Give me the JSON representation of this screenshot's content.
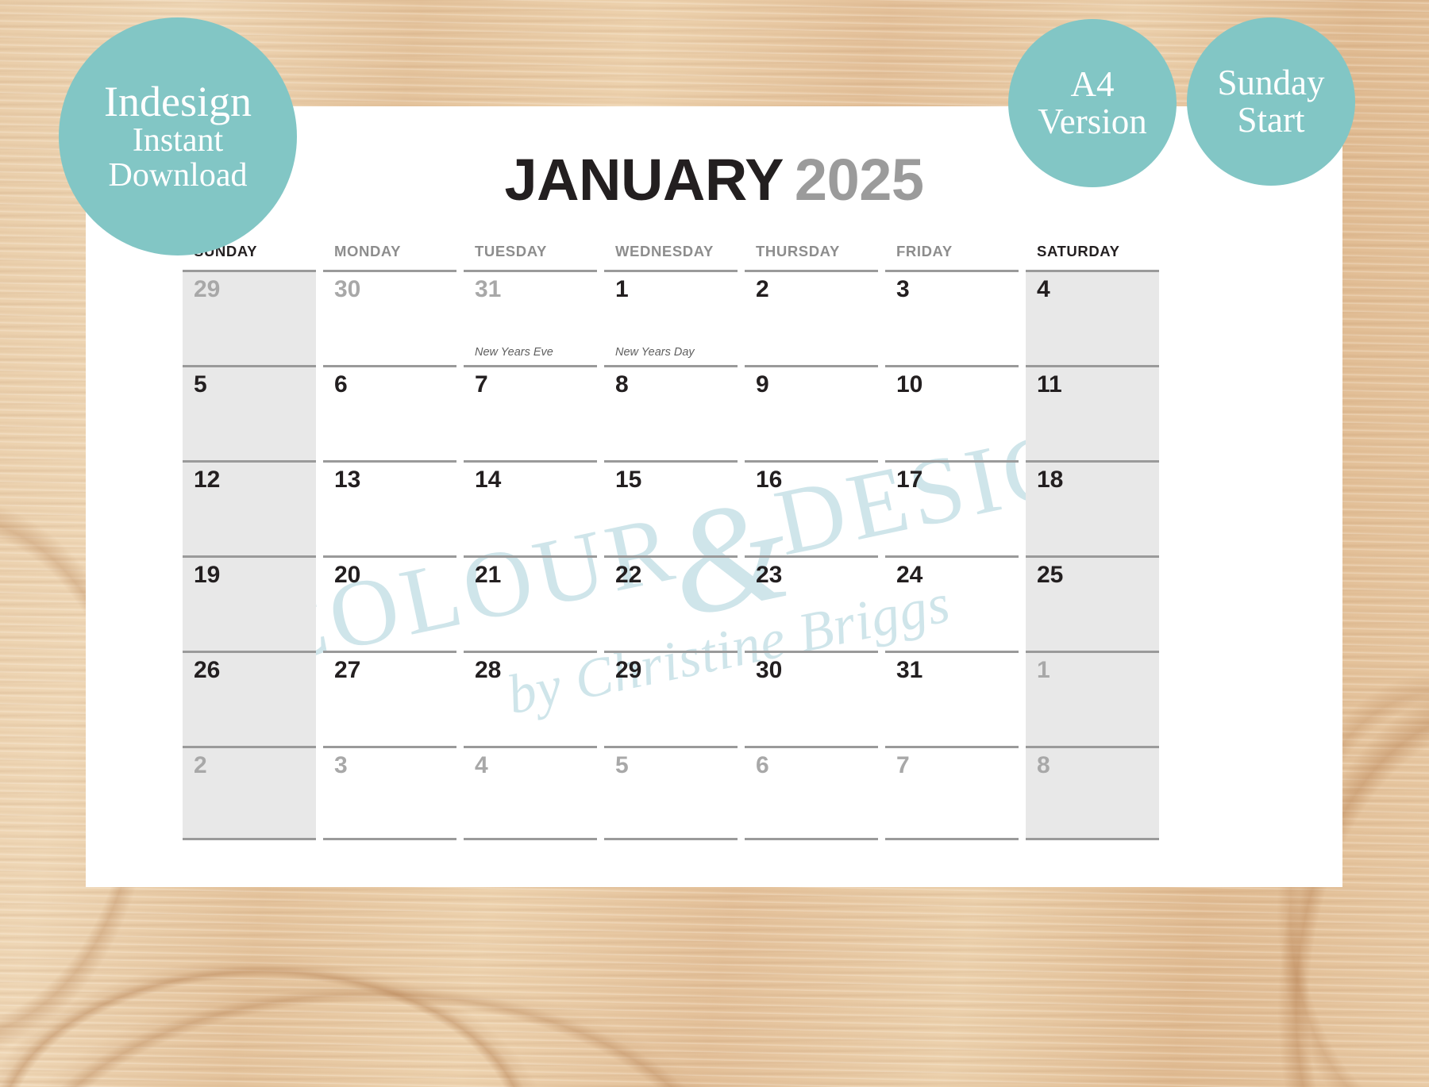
{
  "theme": {
    "teal": "#82c6c5",
    "watermark_blue": "#cfe5ea",
    "shade_gray": "#e8e8e8",
    "rule_gray": "#9a9a9a",
    "out_of_month_gray": "#a8a8a8",
    "wood_beige": "#e2bf99"
  },
  "badges": [
    {
      "name": "indesign-instant-download",
      "lines": [
        "Indesign",
        "Instant",
        "Download"
      ]
    },
    {
      "name": "a4-version",
      "lines": [
        "A4",
        "Version"
      ]
    },
    {
      "name": "sunday-start",
      "lines": [
        "Sunday",
        "Start"
      ]
    }
  ],
  "calendar": {
    "month": "JANUARY",
    "year": "2025",
    "weekday_headers": [
      {
        "label": "SUNDAY",
        "weekend": true
      },
      {
        "label": "MONDAY",
        "weekend": false
      },
      {
        "label": "TUESDAY",
        "weekend": false
      },
      {
        "label": "WEDNESDAY",
        "weekend": false
      },
      {
        "label": "THURSDAY",
        "weekend": false
      },
      {
        "label": "FRIDAY",
        "weekend": false
      },
      {
        "label": "SATURDAY",
        "weekend": true
      }
    ],
    "weeks": [
      [
        {
          "day": "29",
          "out": true,
          "note": ""
        },
        {
          "day": "30",
          "out": true,
          "note": ""
        },
        {
          "day": "31",
          "out": true,
          "note": "New Years Eve"
        },
        {
          "day": "1",
          "out": false,
          "note": "New Years Day"
        },
        {
          "day": "2",
          "out": false,
          "note": ""
        },
        {
          "day": "3",
          "out": false,
          "note": ""
        },
        {
          "day": "4",
          "out": false,
          "note": ""
        }
      ],
      [
        {
          "day": "5",
          "out": false,
          "note": ""
        },
        {
          "day": "6",
          "out": false,
          "note": ""
        },
        {
          "day": "7",
          "out": false,
          "note": ""
        },
        {
          "day": "8",
          "out": false,
          "note": ""
        },
        {
          "day": "9",
          "out": false,
          "note": ""
        },
        {
          "day": "10",
          "out": false,
          "note": ""
        },
        {
          "day": "11",
          "out": false,
          "note": ""
        }
      ],
      [
        {
          "day": "12",
          "out": false,
          "note": ""
        },
        {
          "day": "13",
          "out": false,
          "note": ""
        },
        {
          "day": "14",
          "out": false,
          "note": ""
        },
        {
          "day": "15",
          "out": false,
          "note": ""
        },
        {
          "day": "16",
          "out": false,
          "note": ""
        },
        {
          "day": "17",
          "out": false,
          "note": ""
        },
        {
          "day": "18",
          "out": false,
          "note": ""
        }
      ],
      [
        {
          "day": "19",
          "out": false,
          "note": ""
        },
        {
          "day": "20",
          "out": false,
          "note": ""
        },
        {
          "day": "21",
          "out": false,
          "note": ""
        },
        {
          "day": "22",
          "out": false,
          "note": ""
        },
        {
          "day": "23",
          "out": false,
          "note": ""
        },
        {
          "day": "24",
          "out": false,
          "note": ""
        },
        {
          "day": "25",
          "out": false,
          "note": ""
        }
      ],
      [
        {
          "day": "26",
          "out": false,
          "note": ""
        },
        {
          "day": "27",
          "out": false,
          "note": ""
        },
        {
          "day": "28",
          "out": false,
          "note": ""
        },
        {
          "day": "29",
          "out": false,
          "note": ""
        },
        {
          "day": "30",
          "out": false,
          "note": ""
        },
        {
          "day": "31",
          "out": false,
          "note": ""
        },
        {
          "day": "1",
          "out": true,
          "note": ""
        }
      ],
      [
        {
          "day": "2",
          "out": true,
          "note": ""
        },
        {
          "day": "3",
          "out": true,
          "note": ""
        },
        {
          "day": "4",
          "out": true,
          "note": ""
        },
        {
          "day": "5",
          "out": true,
          "note": ""
        },
        {
          "day": "6",
          "out": true,
          "note": ""
        },
        {
          "day": "7",
          "out": true,
          "note": ""
        },
        {
          "day": "8",
          "out": true,
          "note": ""
        }
      ]
    ],
    "shaded_columns": [
      0,
      6
    ]
  },
  "watermark": {
    "line1_left": "COLOUR",
    "line1_amp": "&",
    "line1_right": "DESIGN",
    "line2": "by Christine Briggs"
  }
}
